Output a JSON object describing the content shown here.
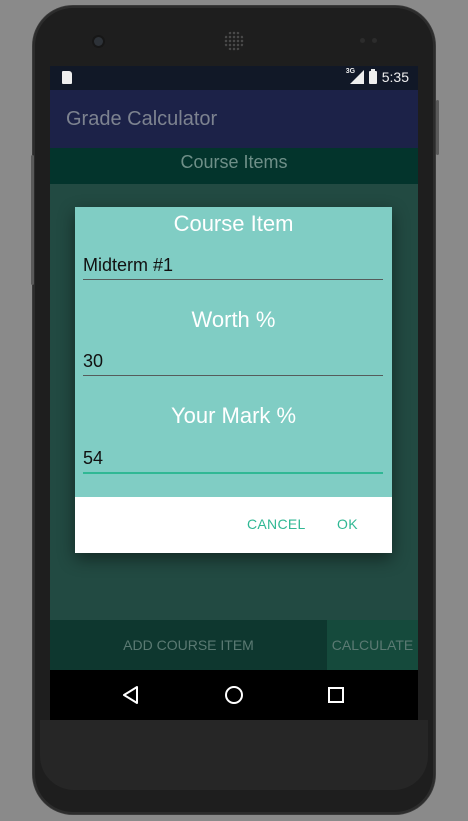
{
  "status_bar": {
    "time": "5:35",
    "network": "3G"
  },
  "app": {
    "title": "Grade Calculator"
  },
  "content": {
    "header": "Course Items"
  },
  "dialog": {
    "course_item_label": "Course Item",
    "course_item_value": "Midterm #1",
    "worth_label": "Worth %",
    "worth_value": "30",
    "mark_label": "Your Mark %",
    "mark_value": "54",
    "cancel_label": "CANCEL",
    "ok_label": "OK"
  },
  "bottom_bar": {
    "add_label": "ADD COURSE ITEM",
    "calculate_label": "CALCULATE"
  },
  "nav": {
    "icons": [
      "back-icon",
      "home-icon",
      "recents-icon"
    ]
  },
  "colors": {
    "accent": "#30b894",
    "dialog_bg": "#80cdc4",
    "app_bar": "#1c2248"
  }
}
